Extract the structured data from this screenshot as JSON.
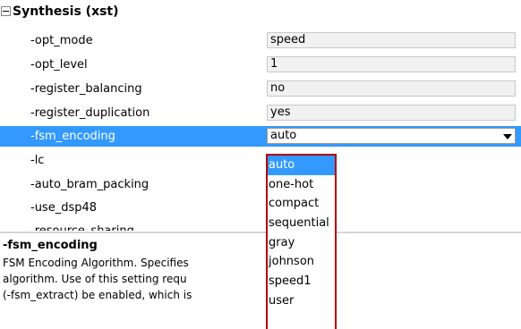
{
  "section": {
    "title": "Synthesis (xst)"
  },
  "rows": [
    {
      "name": "-opt_mode",
      "value": "speed"
    },
    {
      "name": "-opt_level",
      "value": "1"
    },
    {
      "name": "-register_balancing",
      "value": "no"
    },
    {
      "name": "-register_duplication",
      "value": "yes"
    },
    {
      "name": "-fsm_encoding",
      "value": "auto"
    },
    {
      "name": "-lc",
      "value": ""
    },
    {
      "name": "-auto_bram_packing",
      "value": ""
    },
    {
      "name": "-use_dsp48",
      "value": ""
    },
    {
      "name": "-resource_sharing",
      "value": ""
    }
  ],
  "dropdown": {
    "options": [
      "auto",
      "one-hot",
      "compact",
      "sequential",
      "gray",
      "johnson",
      "speed1",
      "user"
    ],
    "selected": "auto"
  },
  "description": {
    "title": "-fsm_encoding",
    "lines": [
      "FSM Encoding Algorithm.  Specifies",
      "algorithm.   Use of this setting requ",
      "(-fsm_extract) be  enabled, which is"
    ]
  },
  "colors": {
    "selection": "#3399ff",
    "dropdown_border": "#b00000"
  }
}
